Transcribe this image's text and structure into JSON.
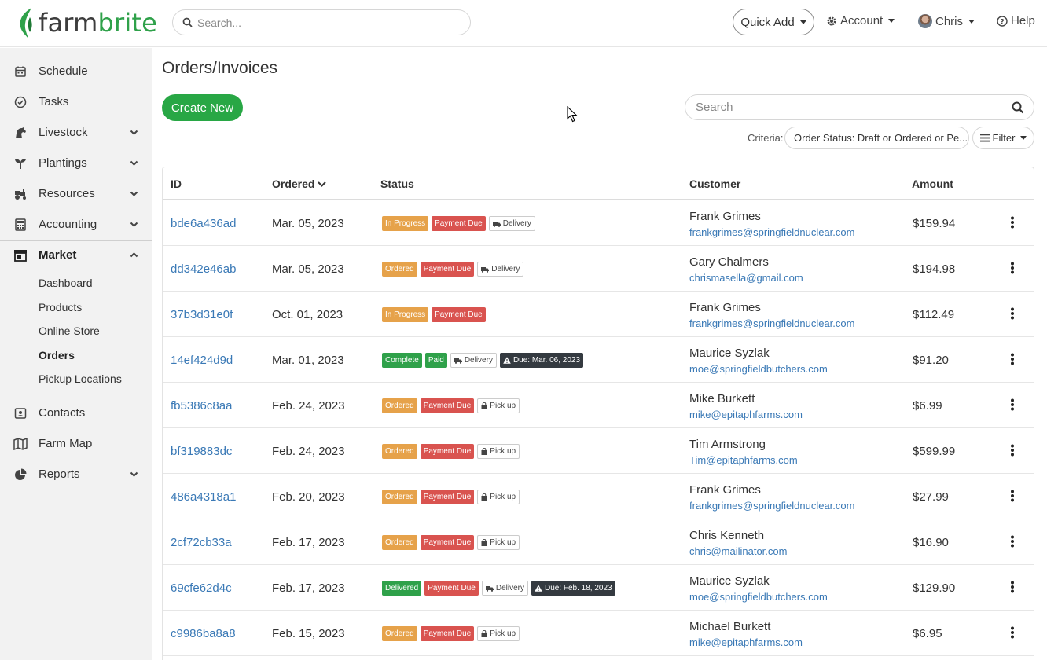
{
  "brand": {
    "name_part1": "farm",
    "name_part2": "brite"
  },
  "header": {
    "search_placeholder": "Search...",
    "quick_add_label": "Quick Add",
    "account_label": "Account",
    "user_label": "Chris",
    "help_label": "Help"
  },
  "sidebar": {
    "items": [
      {
        "label": "Schedule",
        "icon": "calendar-icon"
      },
      {
        "label": "Tasks",
        "icon": "check-circle-icon"
      },
      {
        "label": "Livestock",
        "icon": "horse-icon"
      },
      {
        "label": "Plantings",
        "icon": "seedling-icon"
      },
      {
        "label": "Resources",
        "icon": "tractor-icon"
      },
      {
        "label": "Accounting",
        "icon": "calculator-icon"
      },
      {
        "label": "Market",
        "icon": "store-icon"
      },
      {
        "label": "Contacts",
        "icon": "contact-card-icon"
      },
      {
        "label": "Farm Map",
        "icon": "map-icon"
      },
      {
        "label": "Reports",
        "icon": "pie-chart-icon"
      }
    ],
    "market_sub": [
      {
        "label": "Dashboard"
      },
      {
        "label": "Products"
      },
      {
        "label": "Online Store"
      },
      {
        "label": "Orders"
      },
      {
        "label": "Pickup Locations"
      }
    ]
  },
  "page": {
    "title": "Orders/Invoices",
    "create_label": "Create New",
    "search_placeholder": "Search",
    "criteria_label": "Criteria:",
    "criteria_value": "Order Status: Draft or Ordered or Pe...",
    "filter_label": "Filter"
  },
  "table": {
    "headers": {
      "id": "ID",
      "ordered": "Ordered",
      "status": "Status",
      "customer": "Customer",
      "amount": "Amount"
    },
    "rows": [
      {
        "id": "bde6a436ad",
        "date": "Mar. 05, 2023",
        "badges": [
          {
            "text": "In Progress",
            "kind": "orange"
          },
          {
            "text": "Payment Due",
            "kind": "red"
          },
          {
            "text": "Delivery",
            "kind": "outline",
            "icon": "truck-icon"
          }
        ],
        "name": "Frank Grimes",
        "email": "frankgrimes@springfieldnuclear.com",
        "amount": "$159.94"
      },
      {
        "id": "dd342e46ab",
        "date": "Mar. 05, 2023",
        "badges": [
          {
            "text": "Ordered",
            "kind": "orange"
          },
          {
            "text": "Payment Due",
            "kind": "red"
          },
          {
            "text": "Delivery",
            "kind": "outline",
            "icon": "truck-icon"
          }
        ],
        "name": "Gary Chalmers",
        "email": "chrismasella@gmail.com",
        "amount": "$194.98"
      },
      {
        "id": "37b3d31e0f",
        "date": "Oct. 01, 2023",
        "badges": [
          {
            "text": "In Progress",
            "kind": "orange"
          },
          {
            "text": "Payment Due",
            "kind": "red"
          }
        ],
        "name": "Frank Grimes",
        "email": "frankgrimes@springfieldnuclear.com",
        "amount": "$112.49"
      },
      {
        "id": "14ef424d9d",
        "date": "Mar. 01, 2023",
        "badges": [
          {
            "text": "Complete",
            "kind": "green"
          },
          {
            "text": "Paid",
            "kind": "green"
          },
          {
            "text": "Delivery",
            "kind": "outline",
            "icon": "truck-icon"
          },
          {
            "text": "Due: Mar. 06, 2023",
            "kind": "dark",
            "icon": "warning-icon"
          }
        ],
        "name": "Maurice Syzlak",
        "email": "moe@springfieldbutchers.com",
        "amount": "$91.20"
      },
      {
        "id": "fb5386c8aa",
        "date": "Feb. 24, 2023",
        "badges": [
          {
            "text": "Ordered",
            "kind": "orange"
          },
          {
            "text": "Payment Due",
            "kind": "red"
          },
          {
            "text": "Pick up",
            "kind": "outline",
            "icon": "bag-icon"
          }
        ],
        "name": "Mike Burkett",
        "email": "mike@epitaphfarms.com",
        "amount": "$6.99"
      },
      {
        "id": "bf319883dc",
        "date": "Feb. 24, 2023",
        "badges": [
          {
            "text": "Ordered",
            "kind": "orange"
          },
          {
            "text": "Payment Due",
            "kind": "red"
          },
          {
            "text": "Pick up",
            "kind": "outline",
            "icon": "bag-icon"
          }
        ],
        "name": "Tim Armstrong",
        "email": "Tim@epitaphfarms.com",
        "amount": "$599.99"
      },
      {
        "id": "486a4318a1",
        "date": "Feb. 20, 2023",
        "badges": [
          {
            "text": "Ordered",
            "kind": "orange"
          },
          {
            "text": "Payment Due",
            "kind": "red"
          },
          {
            "text": "Pick up",
            "kind": "outline",
            "icon": "bag-icon"
          }
        ],
        "name": "Frank Grimes",
        "email": "frankgrimes@springfieldnuclear.com",
        "amount": "$27.99"
      },
      {
        "id": "2cf72cb33a",
        "date": "Feb. 17, 2023",
        "badges": [
          {
            "text": "Ordered",
            "kind": "orange"
          },
          {
            "text": "Payment Due",
            "kind": "red"
          },
          {
            "text": "Pick up",
            "kind": "outline",
            "icon": "bag-icon"
          }
        ],
        "name": "Chris Kenneth",
        "email": "chris@mailinator.com",
        "amount": "$16.90"
      },
      {
        "id": "69cfe62d4c",
        "date": "Feb. 17, 2023",
        "badges": [
          {
            "text": "Delivered",
            "kind": "green"
          },
          {
            "text": "Payment Due",
            "kind": "red"
          },
          {
            "text": "Delivery",
            "kind": "outline",
            "icon": "truck-icon"
          },
          {
            "text": "Due: Feb. 18, 2023",
            "kind": "dark",
            "icon": "warning-icon"
          }
        ],
        "name": "Maurice Syzlak",
        "email": "moe@springfieldbutchers.com",
        "amount": "$129.90"
      },
      {
        "id": "c9986ba8a8",
        "date": "Feb. 15, 2023",
        "badges": [
          {
            "text": "Ordered",
            "kind": "orange"
          },
          {
            "text": "Payment Due",
            "kind": "red"
          },
          {
            "text": "Pick up",
            "kind": "outline",
            "icon": "bag-icon"
          }
        ],
        "name": "Michael Burkett",
        "email": "mike@epitaphfarms.com",
        "amount": "$6.95"
      }
    ]
  },
  "colors": {
    "brand_green": "#2fa14a",
    "link_blue": "#3a79b6",
    "badge_orange": "#e6a24a",
    "badge_red": "#d9534f",
    "badge_dark": "#343a40"
  }
}
